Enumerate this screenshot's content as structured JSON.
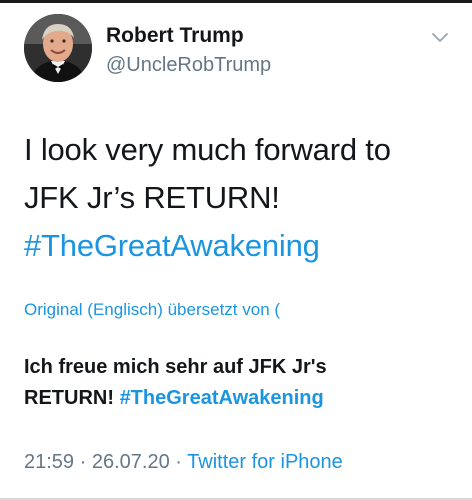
{
  "tweet": {
    "author": {
      "display_name": "Robert Trump",
      "handle": "@UncleRobTrump"
    },
    "menu_icon": "chevron-down-icon",
    "text_line_1": "I look very much forward to",
    "text_line_2": "JFK Jr’s RETURN!",
    "hashtag": "#TheGreatAwakening",
    "translation": {
      "label": "Original (Englisch) übersetzt von (",
      "line_1": "Ich freue mich sehr auf JFK Jr's",
      "line_2_prefix": "RETURN!",
      "hashtag": "#TheGreatAwakening"
    },
    "meta": {
      "time": "21:59",
      "separator_1": "·",
      "date": "26.07.20",
      "separator_2": "·",
      "source": "Twitter for iPhone"
    }
  },
  "colors": {
    "link": "#1b95e0",
    "secondary_text": "#657786",
    "primary_text": "#14171a"
  }
}
